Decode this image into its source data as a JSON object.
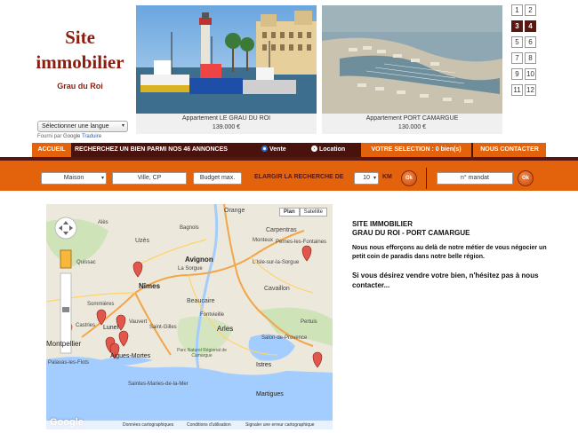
{
  "logo": {
    "line1": "Site",
    "line2": "immobilier",
    "subtitle": "Grau du Roi"
  },
  "language_select": {
    "value": "Sélectionner une langue"
  },
  "translate_credit": {
    "prefix": "Fourni par",
    "google": "Google",
    "brand": "Traduire"
  },
  "listings": [
    {
      "title": "Appartement LE GRAU DU ROI",
      "price": "139.000 €"
    },
    {
      "title": "Appartement PORT CAMARGUE",
      "price": "130.000 €"
    }
  ],
  "pager": [
    "1",
    "2",
    "3",
    "4",
    "5",
    "6",
    "7",
    "8",
    "9",
    "10",
    "11",
    "12"
  ],
  "pager_active": [
    "3",
    "4"
  ],
  "nav": {
    "home": "ACCUEIL",
    "search_text": "RECHERCHEZ UN BIEN PARMI NOS 46 ANNONCES",
    "vente": "Vente",
    "location": "Location",
    "selection": "VOTRE SELECTION : 0 bien(s)",
    "contact": "NOUS CONTACTER"
  },
  "search": {
    "type_value": "Maison",
    "ville_placeholder": "Ville, CP",
    "budget_placeholder": "Budget max.",
    "widen_label": "ELARGIR LA RECHERCHE DE",
    "km_value": "10",
    "km_unit": "KM",
    "ok_label": "Ok",
    "mandat_placeholder": "n° mandat"
  },
  "map": {
    "type_plan": "Plan",
    "type_satellite": "Satellite",
    "logo": "Google",
    "footer": [
      "Données cartographiques",
      "Conditions d'utilisation",
      "Signaler une erreur cartographique"
    ],
    "labels": [
      {
        "name": "Orange"
      },
      {
        "name": "Carpentras"
      },
      {
        "name": "Monteux"
      },
      {
        "name": "Pernes-les-Fontaines"
      },
      {
        "name": "Avignon"
      },
      {
        "name": "L'Isle-sur-la-Sorgue"
      },
      {
        "name": "Uzès"
      },
      {
        "name": "Nîmes"
      },
      {
        "name": "Beaucaire"
      },
      {
        "name": "Cavaillon"
      },
      {
        "name": "Fontvieille"
      },
      {
        "name": "Arles"
      },
      {
        "name": "Salon-de-Provence"
      },
      {
        "name": "Montpellier"
      },
      {
        "name": "Lunel"
      },
      {
        "name": "Vauvert"
      },
      {
        "name": "Saint-Gilles"
      },
      {
        "name": "Castries"
      },
      {
        "name": "Palavas-les-Flots"
      },
      {
        "name": "Aigues-Mortes"
      },
      {
        "name": "Saintes-Maries-de-la-Mer"
      },
      {
        "name": "Istres"
      },
      {
        "name": "Martigues"
      },
      {
        "name": "Parc Naturel Régional de Camargue"
      },
      {
        "name": "Quissac"
      },
      {
        "name": "Sommières"
      },
      {
        "name": "Alès"
      },
      {
        "name": "Pertuis"
      },
      {
        "name": "La Sorgue"
      },
      {
        "name": "Bagnols"
      }
    ]
  },
  "info": {
    "title1": "SITE IMMOBILIER",
    "title2": "GRAU DU ROI - PORT CAMARGUE",
    "paragraph": "Nous nous efforçons au delà de notre métier de vous négocier un petit coin de paradis dans notre belle région.",
    "cta": "Si vous désirez vendre votre bien, n'hésitez pas à nous contacter..."
  },
  "colors": {
    "brand": "#8b1d10",
    "orange": "#e3630c",
    "dark": "#4a120c"
  }
}
